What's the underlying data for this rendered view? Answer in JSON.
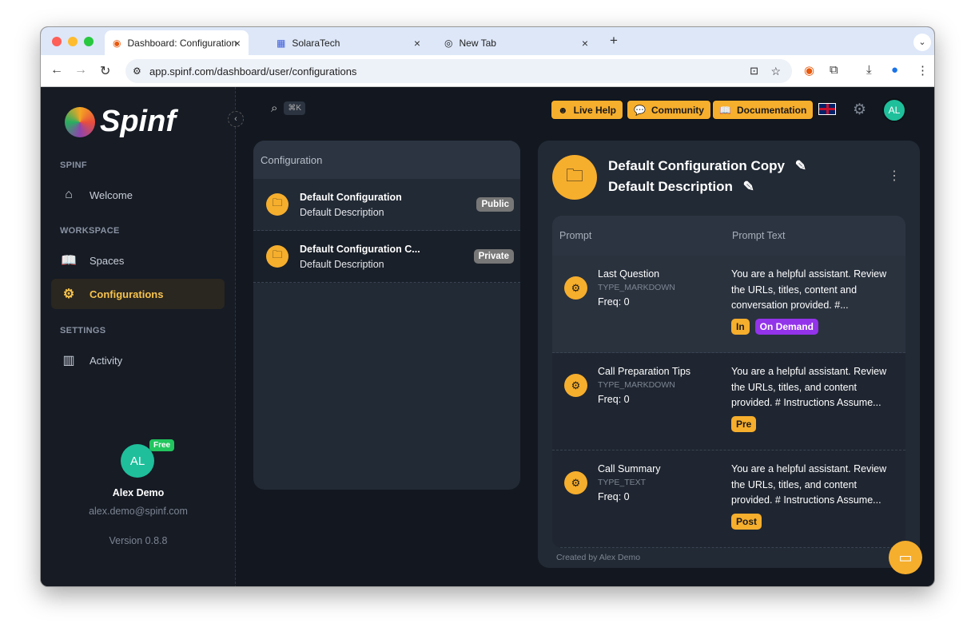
{
  "browser": {
    "tabs": [
      {
        "label": "Dashboard: Configuration",
        "active": true
      },
      {
        "label": "SolaraTech"
      },
      {
        "label": "New Tab"
      }
    ],
    "url": "app.spinf.com/dashboard/user/configurations"
  },
  "sidebar": {
    "logo": "Spinf",
    "sections": [
      {
        "label": "SPINF",
        "items": [
          {
            "label": "Welcome",
            "icon": "home-icon"
          }
        ]
      },
      {
        "label": "WORKSPACE",
        "items": [
          {
            "label": "Spaces",
            "icon": "book-icon"
          },
          {
            "label": "Configurations",
            "icon": "gear-icon",
            "active": true
          }
        ]
      },
      {
        "label": "SETTINGS",
        "items": [
          {
            "label": "Activity",
            "icon": "bar-chart-icon"
          }
        ]
      }
    ],
    "user": {
      "initials": "AL",
      "plan": "Free",
      "name": "Alex Demo",
      "email": "alex.demo@spinf.com",
      "version": "Version 0.8.8"
    }
  },
  "header": {
    "search_shortcut": "⌘K",
    "buttons": [
      "Live Help",
      "Community",
      "Documentation"
    ],
    "avatar": "AL"
  },
  "config_list": {
    "title": "Configuration",
    "items": [
      {
        "title": "Default Configuration",
        "desc": "Default Description",
        "visibility": "Public"
      },
      {
        "title": "Default Configuration C...",
        "desc": "Default Description",
        "visibility": "Private"
      }
    ]
  },
  "detail": {
    "title": "Default Configuration Copy",
    "description": "Default Description",
    "columns": [
      "Prompt",
      "Prompt Text"
    ],
    "prompts": [
      {
        "name": "Last Question",
        "type": "TYPE_MARKDOWN",
        "freq": "Freq: 0",
        "text": "You are a helpful assistant. Review the URLs, titles, content and conversation provided. #...",
        "tags": [
          "In",
          "On Demand"
        ]
      },
      {
        "name": "Call Preparation Tips",
        "type": "TYPE_MARKDOWN",
        "freq": "Freq: 0",
        "text": "You are a helpful assistant. Review the URLs, titles, and content provided. # Instructions Assume...",
        "tags": [
          "Pre"
        ]
      },
      {
        "name": "Call Summary",
        "type": "TYPE_TEXT",
        "freq": "Freq: 0",
        "text": "You are a helpful assistant. Review the URLs, titles, and content provided. # Instructions Assume...",
        "tags": [
          "Post"
        ]
      }
    ],
    "footer": "Created by Alex Demo"
  },
  "colors": {
    "accent": "#f6ae2d",
    "purple": "#9333ea",
    "avatar": "#1fbf9b"
  }
}
